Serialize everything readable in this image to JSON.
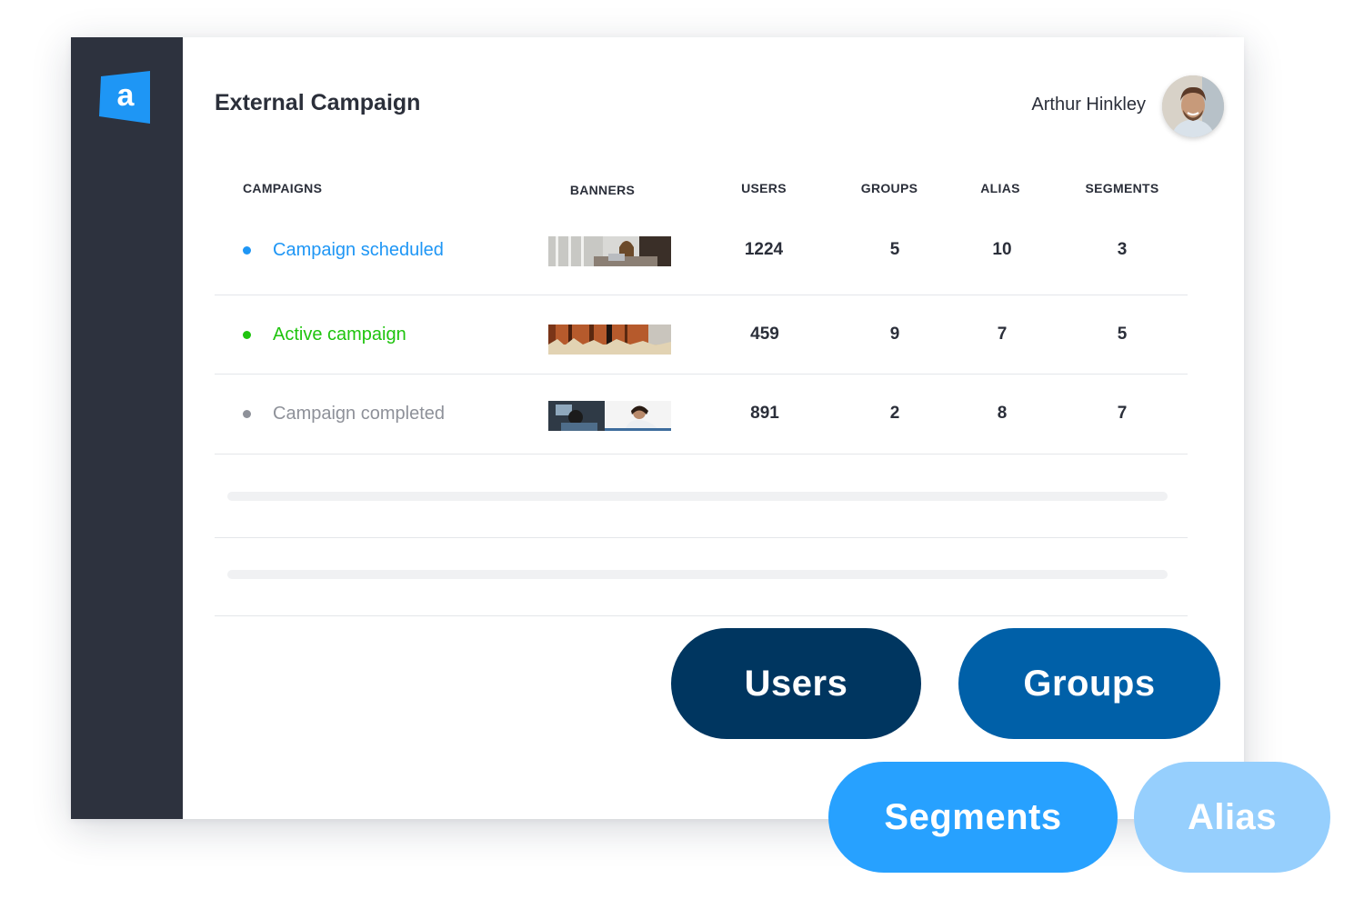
{
  "app": {
    "logo_letter": "a",
    "brand_color": "#1e96f5"
  },
  "header": {
    "title": "External Campaign",
    "user_name": "Arthur Hinkley"
  },
  "table": {
    "columns": [
      "CAMPAIGNS",
      "BANNERS",
      "USERS",
      "GROUPS",
      "ALIAS",
      "SEGMENTS"
    ],
    "rows": [
      {
        "status": "scheduled",
        "label": "Campaign scheduled",
        "color": "#1e96f5",
        "banner": "woman-laptop-banner",
        "users": "1224",
        "groups": "5",
        "alias": "10",
        "segments": "3"
      },
      {
        "status": "active",
        "label": "Active campaign",
        "color": "#1fc40e",
        "banner": "orange-building-banner",
        "users": "459",
        "groups": "9",
        "alias": "7",
        "segments": "5"
      },
      {
        "status": "completed",
        "label": "Campaign completed",
        "color": "#8e9199",
        "banner": "office-people-banner",
        "users": "891",
        "groups": "2",
        "alias": "8",
        "segments": "7"
      }
    ]
  },
  "pills": [
    {
      "label": "Users",
      "color": "#003660"
    },
    {
      "label": "Groups",
      "color": "#0060a8"
    },
    {
      "label": "Segments",
      "color": "#27a1ff"
    },
    {
      "label": "Alias",
      "color": "#96cffd"
    }
  ]
}
